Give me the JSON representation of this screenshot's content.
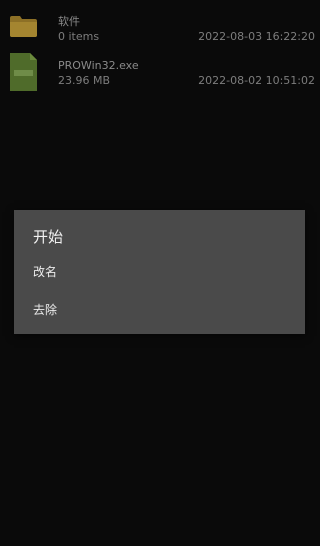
{
  "files": [
    {
      "name": "软件",
      "meta": "0 items",
      "date": "2022-08-03 16:22:20",
      "icon": "folder-icon",
      "color": "#9a7a2a"
    },
    {
      "name": "PROWin32.exe",
      "meta": "23.96 MB",
      "date": "2022-08-02 10:51:02",
      "icon": "exe-file-icon",
      "color": "#4f6b2a"
    }
  ],
  "dialog": {
    "title": "开始",
    "items": [
      {
        "label": "改名"
      },
      {
        "label": "去除"
      }
    ]
  }
}
